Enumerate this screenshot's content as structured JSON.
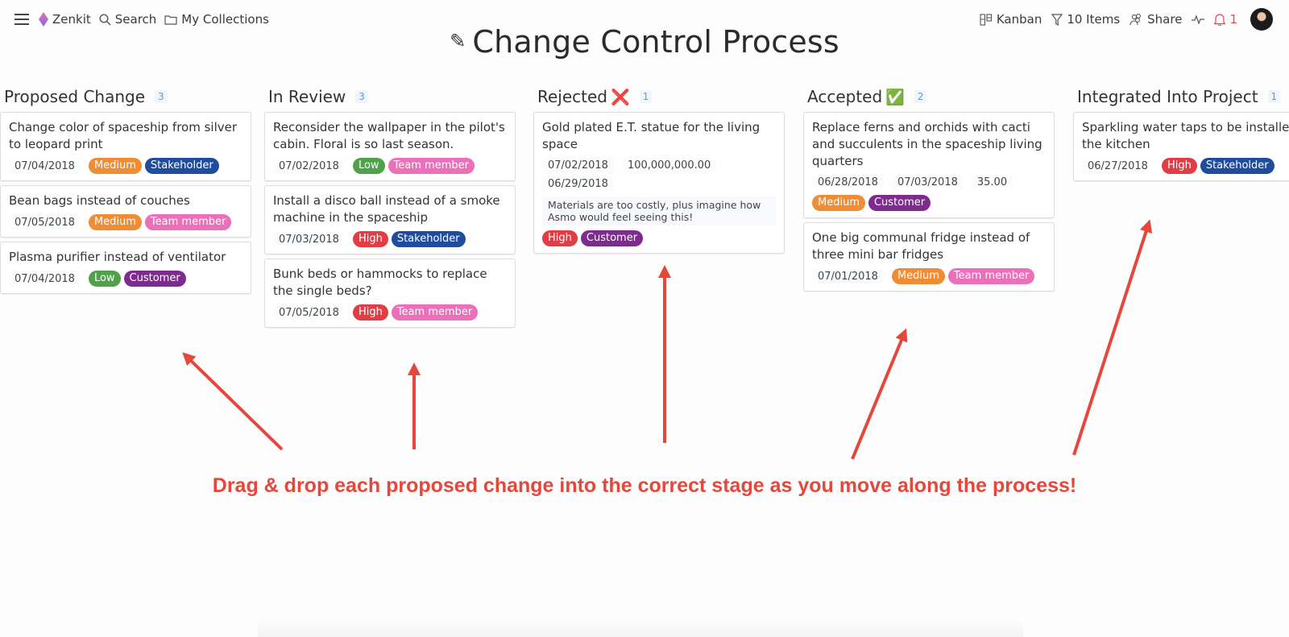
{
  "topbar": {
    "app_name": "Zenkit",
    "search_label": "Search",
    "collections_label": "My Collections",
    "view_label": "Kanban",
    "filter_label": "10 Items",
    "share_label": "Share",
    "notifications_count": "1"
  },
  "title": "Change Control Process",
  "colors": {
    "accent_red": "#e5473b",
    "count_blue": "#5b9bd5",
    "low": "#4fa14a",
    "medium": "#ef8c34",
    "high": "#e23d44",
    "stakeholder": "#1f4c9c",
    "team_member": "#ec6fb9",
    "customer": "#7e2a8f"
  },
  "columns": [
    {
      "title": "Proposed Change",
      "emoji": "",
      "count": "3",
      "cards": [
        {
          "title": "Change color of spaceship from silver to leopard print",
          "values": [
            "07/04/2018"
          ],
          "tags": [
            {
              "label": "Medium",
              "kind": "medium"
            },
            {
              "label": "Stakeholder",
              "kind": "stakeholder"
            }
          ]
        },
        {
          "title": "Bean bags instead of couches",
          "values": [
            "07/05/2018"
          ],
          "tags": [
            {
              "label": "Medium",
              "kind": "medium"
            },
            {
              "label": "Team member",
              "kind": "team_member"
            }
          ]
        },
        {
          "title": "Plasma purifier instead of ventilator",
          "values": [
            "07/04/2018"
          ],
          "tags": [
            {
              "label": "Low",
              "kind": "low"
            },
            {
              "label": "Customer",
              "kind": "customer"
            }
          ]
        }
      ]
    },
    {
      "title": "In Review",
      "emoji": "",
      "count": "3",
      "cards": [
        {
          "title": "Reconsider the wallpaper in the pilot's cabin. Floral is so last season.",
          "values": [
            "07/02/2018"
          ],
          "tags": [
            {
              "label": "Low",
              "kind": "low"
            },
            {
              "label": "Team member",
              "kind": "team_member"
            }
          ]
        },
        {
          "title": "Install a disco ball instead of a smoke machine in the spaceship",
          "values": [
            "07/03/2018"
          ],
          "tags": [
            {
              "label": "High",
              "kind": "high"
            },
            {
              "label": "Stakeholder",
              "kind": "stakeholder"
            }
          ]
        },
        {
          "title": "Bunk beds or hammocks to replace the single beds?",
          "values": [
            "07/05/2018"
          ],
          "tags": [
            {
              "label": "High",
              "kind": "high"
            },
            {
              "label": "Team member",
              "kind": "team_member"
            }
          ]
        }
      ]
    },
    {
      "title": "Rejected",
      "emoji": "❌",
      "count": "1",
      "cards": [
        {
          "title": "Gold plated E.T. statue for the living space",
          "values": [
            "07/02/2018",
            "100,000,000.00",
            "06/29/2018"
          ],
          "note": "Materials are too costly, plus imagine how Asmo would feel seeing this!",
          "tags_on_new_line": true,
          "tags": [
            {
              "label": "High",
              "kind": "high"
            },
            {
              "label": "Customer",
              "kind": "customer"
            }
          ]
        }
      ]
    },
    {
      "title": "Accepted",
      "emoji": "✅",
      "count": "2",
      "cards": [
        {
          "title": "Replace ferns and orchids with cacti and succulents in the spaceship living quarters",
          "values": [
            "06/28/2018",
            "07/03/2018",
            "35.00"
          ],
          "tags_on_new_line": true,
          "tags": [
            {
              "label": "Medium",
              "kind": "medium"
            },
            {
              "label": "Customer",
              "kind": "customer"
            }
          ]
        },
        {
          "title": "One big communal fridge instead of three mini bar fridges",
          "values": [
            "07/01/2018"
          ],
          "tags": [
            {
              "label": "Medium",
              "kind": "medium"
            },
            {
              "label": "Team member",
              "kind": "team_member"
            }
          ]
        }
      ]
    },
    {
      "title": "Integrated Into Project",
      "emoji": "",
      "count": "1",
      "cards": [
        {
          "title": "Sparkling water taps to be installed in the kitchen",
          "values": [
            "06/27/2018"
          ],
          "tags": [
            {
              "label": "High",
              "kind": "high"
            },
            {
              "label": "Stakeholder",
              "kind": "stakeholder"
            }
          ]
        }
      ]
    }
  ],
  "instruction": "Drag & drop each proposed change into the correct stage as you move along the process!"
}
